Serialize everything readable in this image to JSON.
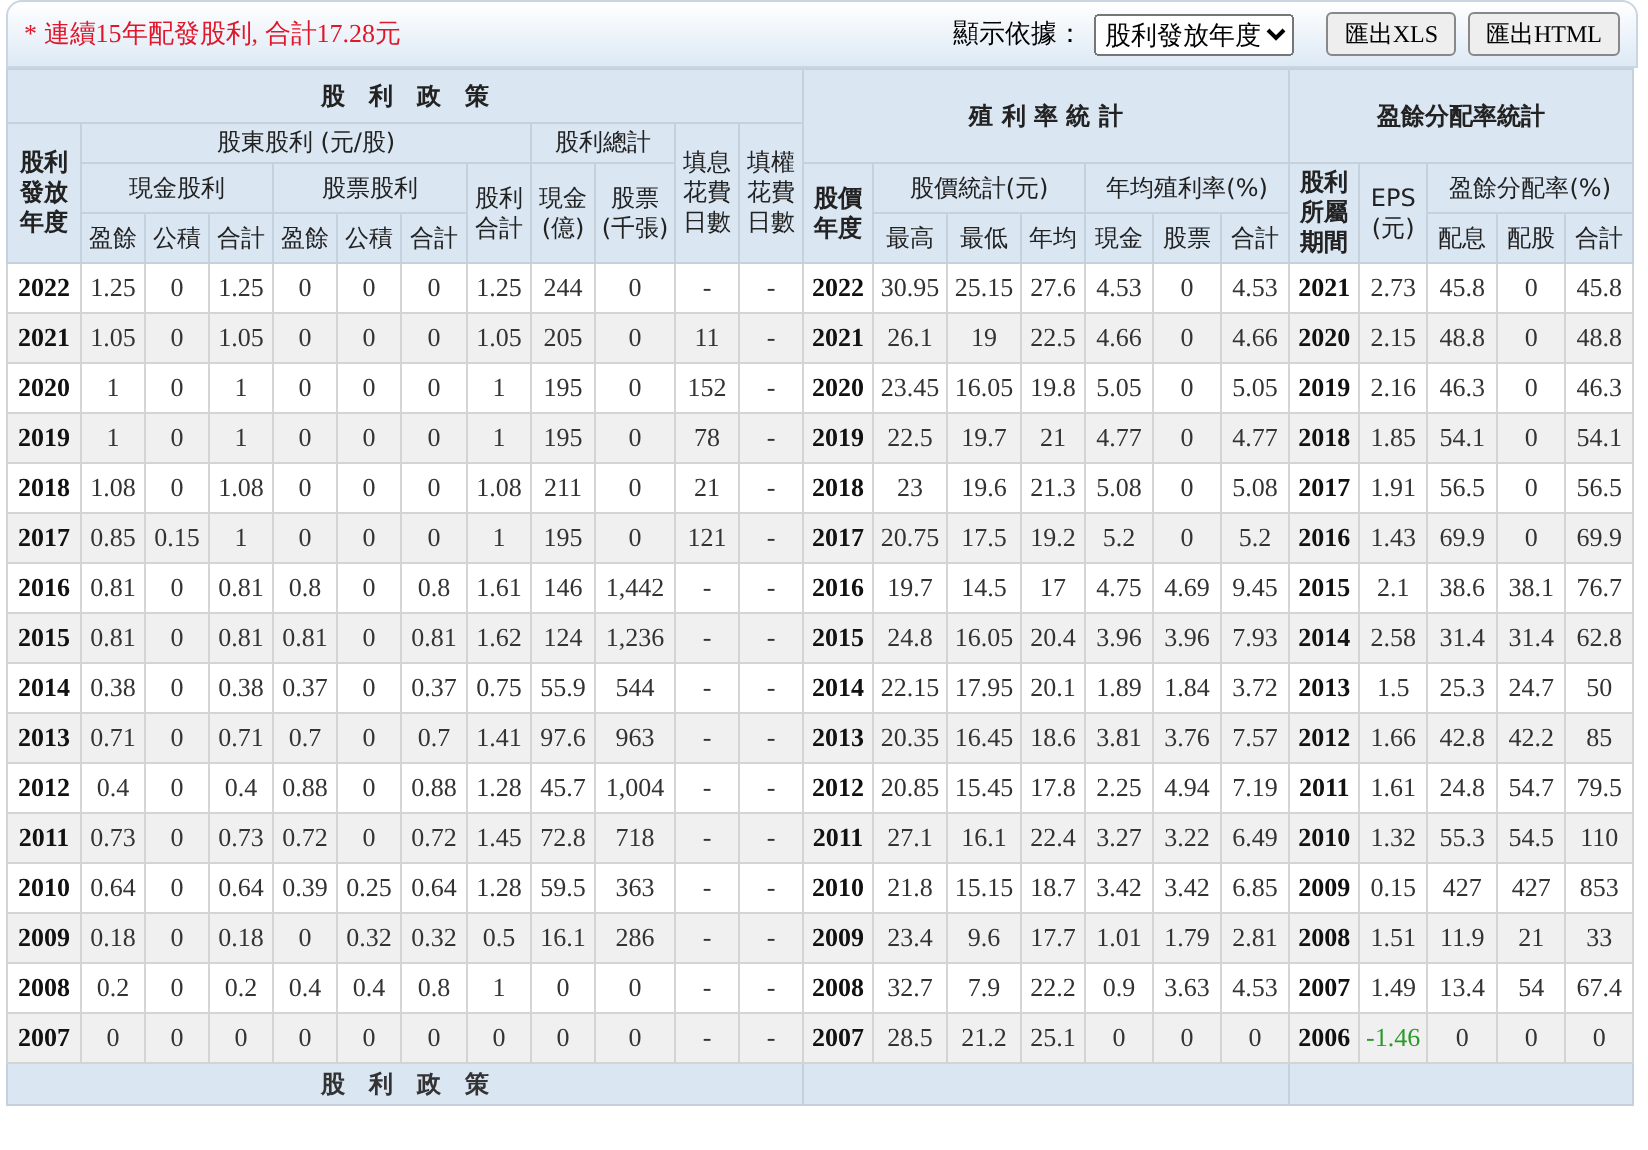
{
  "toolbar": {
    "notice": "* 連續15年配發股利, 合計17.28元",
    "display_label": "顯示依據：",
    "display_select": "股利發放年度",
    "buttons": [
      "匯出XLS",
      "匯出HTML"
    ]
  },
  "table": {
    "group_headers": [
      "股　利　政　策",
      "殖 利 率 統 計",
      "盈餘分配率統計"
    ],
    "header_row_2": [
      "股利發放年度",
      "股東股利 (元/股)",
      "股利總計",
      "填息花費日數",
      "填權花費日數"
    ],
    "header_row_3": [
      "現金股利",
      "股票股利",
      "股利合計",
      "現金(億)",
      "股票(千張)",
      "股價年度",
      "股價統計(元)",
      "年均殖利率(%)",
      "股利所屬期間",
      "EPS(元)",
      "盈餘分配率(%)"
    ],
    "header_row_4": [
      "盈餘",
      "公積",
      "合計",
      "盈餘",
      "公積",
      "合計",
      "最高",
      "最低",
      "年均",
      "現金",
      "股票",
      "合計",
      "配息",
      "配股",
      "合計"
    ],
    "rows": [
      {
        "cells": [
          "2022",
          "1.25",
          "0",
          "1.25",
          "0",
          "0",
          "0",
          "1.25",
          "244",
          "0",
          "-",
          "-",
          "2022",
          "30.95",
          "25.15",
          "27.6",
          "4.53",
          "0",
          "4.53",
          "2021",
          "2.73",
          "45.8",
          "0",
          "45.8"
        ],
        "eps_loss": false
      },
      {
        "cells": [
          "2021",
          "1.05",
          "0",
          "1.05",
          "0",
          "0",
          "0",
          "1.05",
          "205",
          "0",
          "11",
          "-",
          "2021",
          "26.1",
          "19",
          "22.5",
          "4.66",
          "0",
          "4.66",
          "2020",
          "2.15",
          "48.8",
          "0",
          "48.8"
        ],
        "eps_loss": false
      },
      {
        "cells": [
          "2020",
          "1",
          "0",
          "1",
          "0",
          "0",
          "0",
          "1",
          "195",
          "0",
          "152",
          "-",
          "2020",
          "23.45",
          "16.05",
          "19.8",
          "5.05",
          "0",
          "5.05",
          "2019",
          "2.16",
          "46.3",
          "0",
          "46.3"
        ],
        "eps_loss": false
      },
      {
        "cells": [
          "2019",
          "1",
          "0",
          "1",
          "0",
          "0",
          "0",
          "1",
          "195",
          "0",
          "78",
          "-",
          "2019",
          "22.5",
          "19.7",
          "21",
          "4.77",
          "0",
          "4.77",
          "2018",
          "1.85",
          "54.1",
          "0",
          "54.1"
        ],
        "eps_loss": false
      },
      {
        "cells": [
          "2018",
          "1.08",
          "0",
          "1.08",
          "0",
          "0",
          "0",
          "1.08",
          "211",
          "0",
          "21",
          "-",
          "2018",
          "23",
          "19.6",
          "21.3",
          "5.08",
          "0",
          "5.08",
          "2017",
          "1.91",
          "56.5",
          "0",
          "56.5"
        ],
        "eps_loss": false
      },
      {
        "cells": [
          "2017",
          "0.85",
          "0.15",
          "1",
          "0",
          "0",
          "0",
          "1",
          "195",
          "0",
          "121",
          "-",
          "2017",
          "20.75",
          "17.5",
          "19.2",
          "5.2",
          "0",
          "5.2",
          "2016",
          "1.43",
          "69.9",
          "0",
          "69.9"
        ],
        "eps_loss": false
      },
      {
        "cells": [
          "2016",
          "0.81",
          "0",
          "0.81",
          "0.8",
          "0",
          "0.8",
          "1.61",
          "146",
          "1,442",
          "-",
          "-",
          "2016",
          "19.7",
          "14.5",
          "17",
          "4.75",
          "4.69",
          "9.45",
          "2015",
          "2.1",
          "38.6",
          "38.1",
          "76.7"
        ],
        "eps_loss": false
      },
      {
        "cells": [
          "2015",
          "0.81",
          "0",
          "0.81",
          "0.81",
          "0",
          "0.81",
          "1.62",
          "124",
          "1,236",
          "-",
          "-",
          "2015",
          "24.8",
          "16.05",
          "20.4",
          "3.96",
          "3.96",
          "7.93",
          "2014",
          "2.58",
          "31.4",
          "31.4",
          "62.8"
        ],
        "eps_loss": false
      },
      {
        "cells": [
          "2014",
          "0.38",
          "0",
          "0.38",
          "0.37",
          "0",
          "0.37",
          "0.75",
          "55.9",
          "544",
          "-",
          "-",
          "2014",
          "22.15",
          "17.95",
          "20.1",
          "1.89",
          "1.84",
          "3.72",
          "2013",
          "1.5",
          "25.3",
          "24.7",
          "50"
        ],
        "eps_loss": false
      },
      {
        "cells": [
          "2013",
          "0.71",
          "0",
          "0.71",
          "0.7",
          "0",
          "0.7",
          "1.41",
          "97.6",
          "963",
          "-",
          "-",
          "2013",
          "20.35",
          "16.45",
          "18.6",
          "3.81",
          "3.76",
          "7.57",
          "2012",
          "1.66",
          "42.8",
          "42.2",
          "85"
        ],
        "eps_loss": false
      },
      {
        "cells": [
          "2012",
          "0.4",
          "0",
          "0.4",
          "0.88",
          "0",
          "0.88",
          "1.28",
          "45.7",
          "1,004",
          "-",
          "-",
          "2012",
          "20.85",
          "15.45",
          "17.8",
          "2.25",
          "4.94",
          "7.19",
          "2011",
          "1.61",
          "24.8",
          "54.7",
          "79.5"
        ],
        "eps_loss": false
      },
      {
        "cells": [
          "2011",
          "0.73",
          "0",
          "0.73",
          "0.72",
          "0",
          "0.72",
          "1.45",
          "72.8",
          "718",
          "-",
          "-",
          "2011",
          "27.1",
          "16.1",
          "22.4",
          "3.27",
          "3.22",
          "6.49",
          "2010",
          "1.32",
          "55.3",
          "54.5",
          "110"
        ],
        "eps_loss": false
      },
      {
        "cells": [
          "2010",
          "0.64",
          "0",
          "0.64",
          "0.39",
          "0.25",
          "0.64",
          "1.28",
          "59.5",
          "363",
          "-",
          "-",
          "2010",
          "21.8",
          "15.15",
          "18.7",
          "3.42",
          "3.42",
          "6.85",
          "2009",
          "0.15",
          "427",
          "427",
          "853"
        ],
        "eps_loss": false
      },
      {
        "cells": [
          "2009",
          "0.18",
          "0",
          "0.18",
          "0",
          "0.32",
          "0.32",
          "0.5",
          "16.1",
          "286",
          "-",
          "-",
          "2009",
          "23.4",
          "9.6",
          "17.7",
          "1.01",
          "1.79",
          "2.81",
          "2008",
          "1.51",
          "11.9",
          "21",
          "33"
        ],
        "eps_loss": false
      },
      {
        "cells": [
          "2008",
          "0.2",
          "0",
          "0.2",
          "0.4",
          "0.4",
          "0.8",
          "1",
          "0",
          "0",
          "-",
          "-",
          "2008",
          "32.7",
          "7.9",
          "22.2",
          "0.9",
          "3.63",
          "4.53",
          "2007",
          "1.49",
          "13.4",
          "54",
          "67.4"
        ],
        "eps_loss": false
      },
      {
        "cells": [
          "2007",
          "0",
          "0",
          "0",
          "0",
          "0",
          "0",
          "0",
          "0",
          "0",
          "-",
          "-",
          "2007",
          "28.5",
          "21.2",
          "25.1",
          "0",
          "0",
          "0",
          "2006",
          "-1.46",
          "0",
          "0",
          "0"
        ],
        "eps_loss": true
      }
    ],
    "footer_header": "股　利　政　策"
  }
}
